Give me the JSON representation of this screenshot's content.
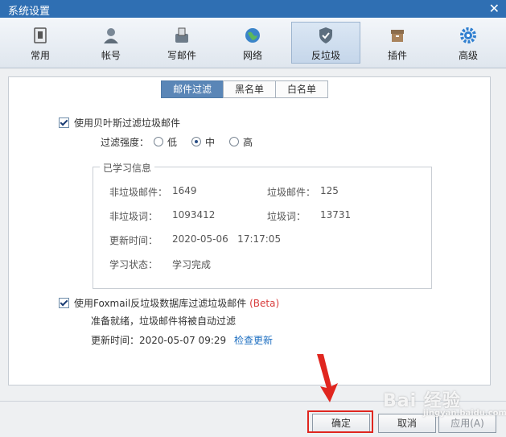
{
  "window": {
    "title": "系统设置"
  },
  "toolbar": [
    {
      "label": "常用",
      "icon": "general-icon"
    },
    {
      "label": "帐号",
      "icon": "account-icon"
    },
    {
      "label": "写邮件",
      "icon": "compose-icon"
    },
    {
      "label": "网络",
      "icon": "network-icon"
    },
    {
      "label": "反垃圾",
      "icon": "shield-icon",
      "active": true
    },
    {
      "label": "插件",
      "icon": "plugin-icon"
    },
    {
      "label": "高级",
      "icon": "gear-icon"
    }
  ],
  "tabs": [
    {
      "label": "邮件过滤",
      "active": true
    },
    {
      "label": "黑名单"
    },
    {
      "label": "白名单"
    }
  ],
  "bayes": {
    "label": "使用贝叶斯过滤垃圾邮件",
    "checked": true,
    "strength_label": "过滤强度：",
    "options": [
      "低",
      "中",
      "高"
    ],
    "selected": "中"
  },
  "learned": {
    "legend": "已学习信息",
    "nonspam_mail_label": "非垃圾邮件：",
    "nonspam_mail_value": "1649",
    "spam_mail_label": "垃圾邮件：",
    "spam_mail_value": "125",
    "nonspam_word_label": "非垃圾词：",
    "nonspam_word_value": "1093412",
    "spam_word_label": "垃圾词：",
    "spam_word_value": "13731",
    "update_label": "更新时间：",
    "update_value": "2020-05-06   17:17:05",
    "status_label": "学习状态：",
    "status_value": "学习完成"
  },
  "foxmail_db": {
    "label": "使用Foxmail反垃圾数据库过滤垃圾邮件",
    "beta": "(Beta)",
    "checked": true,
    "ready_text": "准备就绪，垃圾邮件将被自动过滤",
    "update_text": "更新时间：2020-05-07 09:29",
    "check_update": "检查更新"
  },
  "buttons": {
    "ok": "确定",
    "cancel": "取消",
    "apply": "应用(A)"
  },
  "watermark": {
    "text": "Bai 经验",
    "sub": "jingyan.baidu.com"
  },
  "colors": {
    "accent": "#2f6fb3",
    "highlight": "#e0261f",
    "beta": "#d83b3b",
    "link": "#1e6fc1"
  }
}
